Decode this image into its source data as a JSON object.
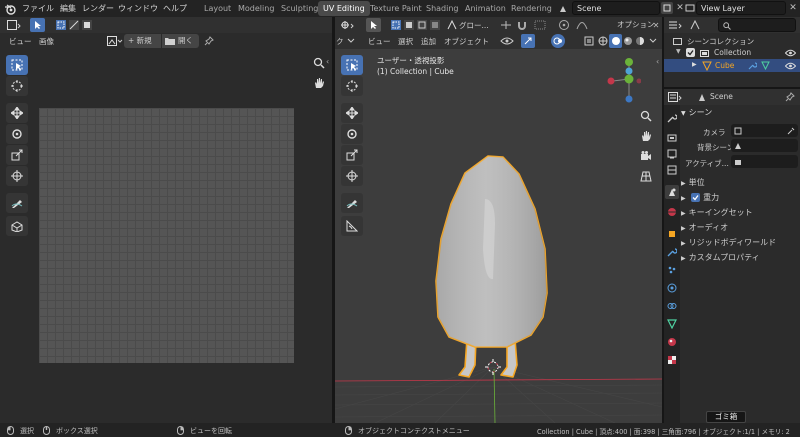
{
  "menubar": {
    "items": [
      "ファイル",
      "編集",
      "レンダー",
      "ウィンドウ",
      "ヘルプ"
    ],
    "workspaces": [
      "Layout",
      "Modeling",
      "Sculpting",
      "UV Editing",
      "Texture Paint",
      "Shading",
      "Animation",
      "Rendering"
    ],
    "active_workspace": "UV Editing",
    "scene": "Scene",
    "view_layer": "View Layer"
  },
  "uv_editor": {
    "menus": [
      "ビュー",
      "画像"
    ],
    "new_label": "+ 新規",
    "open_label": "開く"
  },
  "viewport": {
    "menus": [
      "ビュー",
      "選択",
      "追加",
      "オブジェクト"
    ],
    "orientation": "グロー...",
    "options_label": "オプション",
    "mode_label": "ク",
    "view_title": "ユーザー・透視投影",
    "view_subtitle": "(1) Collection | Cube"
  },
  "outliner": {
    "search_placeholder": "",
    "root": "シーンコレクション",
    "collection": "Collection",
    "object": "Cube"
  },
  "properties": {
    "scene_name": "Scene",
    "section_scene": "シーン",
    "camera_label": "カメラ",
    "bg_scene_label": "背景シーン",
    "active_clip_label": "アクティブ...",
    "panels": [
      "単位",
      "重力",
      "キーイングセット",
      "オーディオ",
      "リジッドボディワールド",
      "カスタムプロパティ"
    ],
    "gravity_checked": true
  },
  "trash_tooltip": "ゴミ箱",
  "statusbar": {
    "select": "選択",
    "box_select": "ボックス選択",
    "rotate_view": "ビューを回転",
    "context_menu": "オブジェクトコンテクストメニュー",
    "stats": "Collection | Cube | 頂点:400 | 面:398 | 三角面:796 | オブジェクト:1/1 | メモリ: 2"
  },
  "colors": {
    "accent": "#4772b3",
    "selection_outline": "#f5a623",
    "x_axis": "#c4374a",
    "y_axis": "#6bb23a"
  }
}
